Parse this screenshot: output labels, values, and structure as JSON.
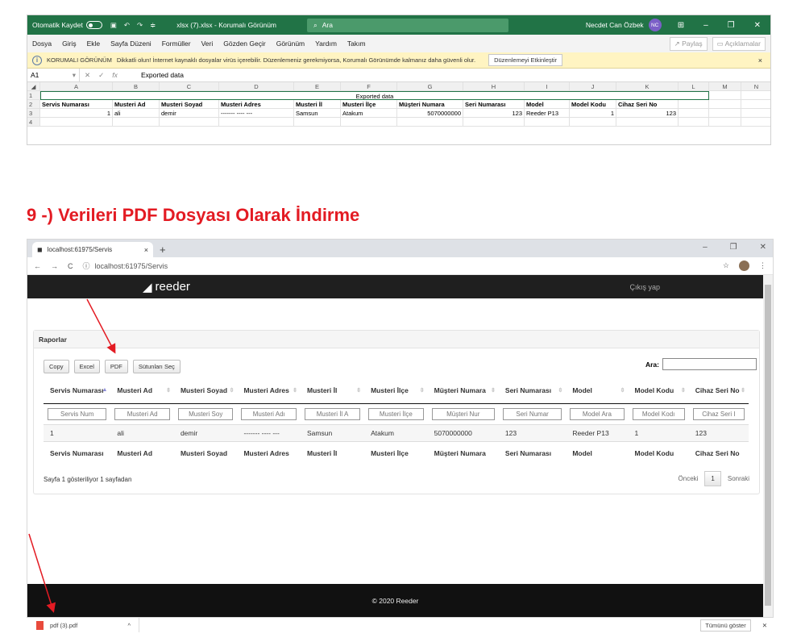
{
  "excel": {
    "autosave_label": "Otomatik Kaydet",
    "file_title": "xlsx (7).xlsx - Korumalı Görünüm",
    "search_placeholder": "Ara",
    "user_name": "Necdet Can Özbek",
    "user_initials": "NC",
    "menu": [
      "Dosya",
      "Giriş",
      "Ekle",
      "Sayfa Düzeni",
      "Formüller",
      "Veri",
      "Gözden Geçir",
      "Görünüm",
      "Yardım",
      "Takım"
    ],
    "share_label": "Paylaş",
    "comments_label": "Açıklamalar",
    "protected_title": "KORUMALI GÖRÜNÜM",
    "protected_msg": "Dikkatli olun! İnternet kaynaklı dosyalar virüs içerebilir. Düzenlemeniz gerekmiyorsa, Korumalı Görünümde kalmanız daha güvenli olur.",
    "enable_editing": "Düzenlemeyi Etkinleştir",
    "name_box": "A1",
    "formula_value": "Exported data",
    "col_letters": [
      "A",
      "B",
      "C",
      "D",
      "E",
      "F",
      "G",
      "H",
      "I",
      "J",
      "K",
      "L",
      "M",
      "N"
    ],
    "merged_title": "Exported data",
    "headers": [
      "Servis Numarası",
      "Musteri Ad",
      "Musteri Soyad",
      "Musteri Adres",
      "Musteri İl",
      "Musteri İlçe",
      "Müşteri Numara",
      "Seri Numarası",
      "Model",
      "Model Kodu",
      "Cihaz Seri No"
    ],
    "row3": [
      "1",
      "ali",
      "demir",
      "------- ---- ---",
      "Samsun",
      "Atakum",
      "5070000000",
      "123",
      "Reeder P13",
      "1",
      "123"
    ]
  },
  "heading": "9 -) Verileri PDF Dosyası Olarak İndirme",
  "browser": {
    "tab_title": "localhost:61975/Servis",
    "url": "localhost:61975/Servis",
    "brand": "reeder",
    "logout": "Çıkış yap",
    "panel_title": "Raporlar",
    "buttons": [
      "Copy",
      "Excel",
      "PDF",
      "Sütunları Seç"
    ],
    "search_label": "Ara:",
    "columns": [
      "Servis Numarası",
      "Musteri Ad",
      "Musteri Soyad",
      "Musteri Adres",
      "Musteri İl",
      "Musteri İlçe",
      "Müşteri Numara",
      "Seri Numarası",
      "Model",
      "Model Kodu",
      "Cihaz Seri No"
    ],
    "filters": [
      "Servis Num",
      "Musteri Ad",
      "Musteri Soy",
      "Musteri Adı",
      "Musteri İl A",
      "Musteri İlçe",
      "Müşteri Nur",
      "Seri Numar",
      "Model Ara",
      "Model Kodı",
      "Cihaz Seri I"
    ],
    "row": [
      "1",
      "ali",
      "demir",
      "------- ---- ---",
      "Samsun",
      "Atakum",
      "5070000000",
      "123",
      "Reeder P13",
      "1",
      "123"
    ],
    "info": "Sayfa 1 gösteriliyor 1 sayfadan",
    "prev": "Önceki",
    "page": "1",
    "next": "Sonraki",
    "footer": "© 2020 Reeder"
  },
  "download": {
    "file": "pdf (3).pdf",
    "show_all": "Tümünü göster"
  },
  "colors": {
    "excel_green": "#217346",
    "heading_red": "#e31b23",
    "arrow_red": "#e31b23"
  }
}
